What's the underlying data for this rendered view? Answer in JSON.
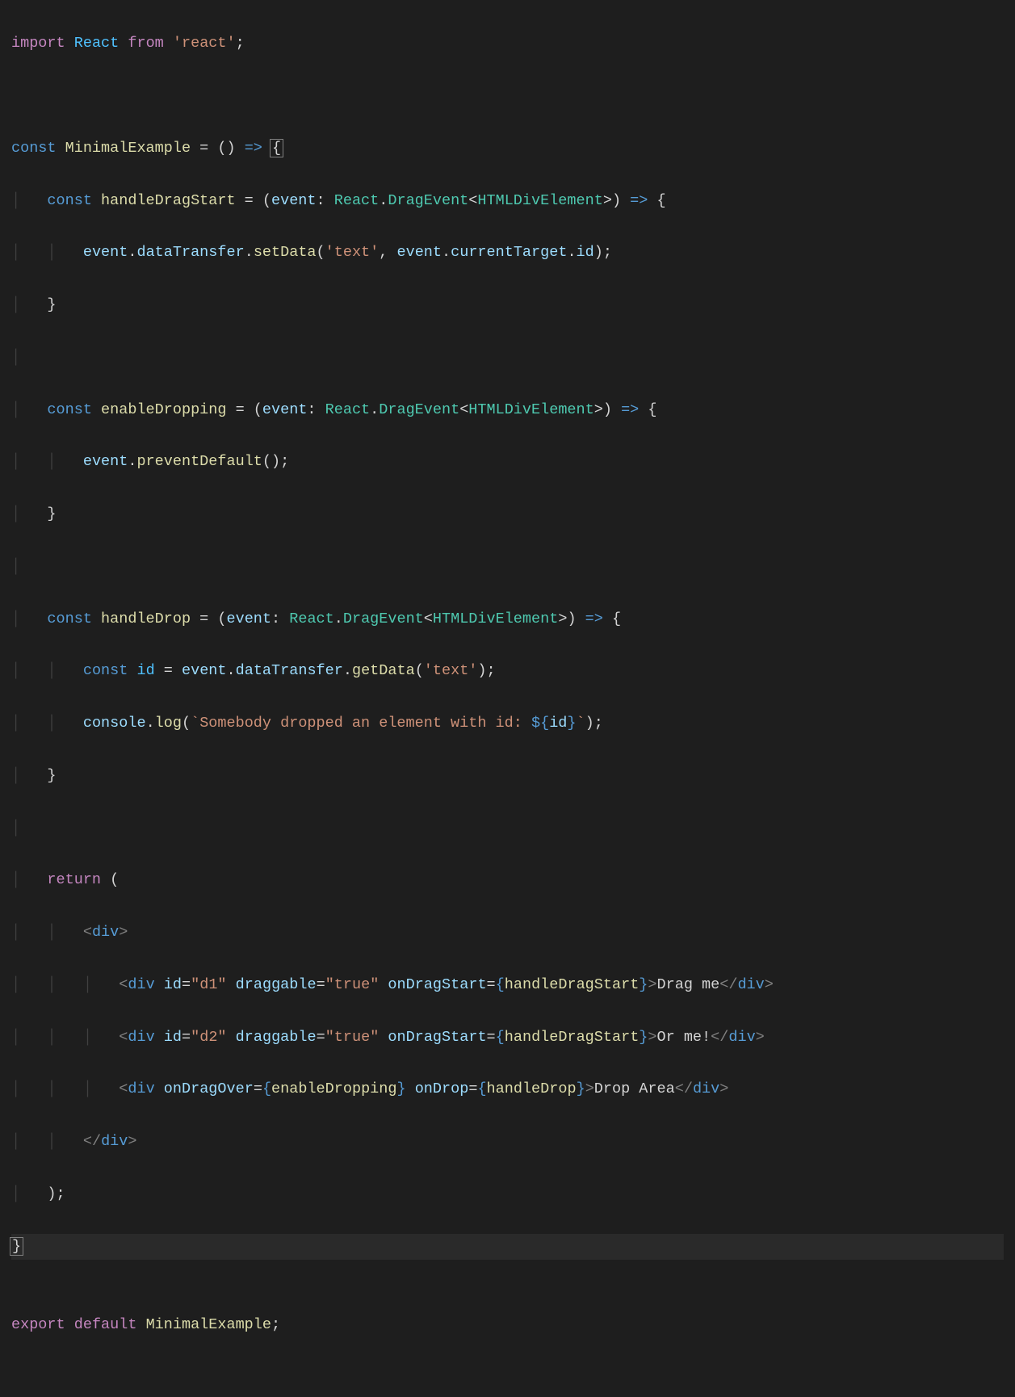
{
  "code": {
    "l1": {
      "import": "import",
      "react": "React",
      "from": "from",
      "pkg": "'react'",
      "semi": ";"
    },
    "l3": {
      "const": "const",
      "name": "MinimalExample",
      "eq": " = ",
      "parens": "()",
      "arrow": " => ",
      "brace": "{"
    },
    "l4": {
      "const": "const",
      "name": "handleDragStart",
      "eq": " = (",
      "param": "event",
      "colon": ": ",
      "ns": "React",
      "dot": ".",
      "type": "DragEvent",
      "lt": "<",
      "gen": "HTMLDivElement",
      "gt": ">",
      "close": ") ",
      "arrow": "=> ",
      "brace": "{"
    },
    "l5": {
      "ev": "event",
      "dot1": ".",
      "dt": "dataTransfer",
      "dot2": ".",
      "fn": "setData",
      "open": "(",
      "s1": "'text'",
      "comma": ", ",
      "ev2": "event",
      "dot3": ".",
      "ct": "currentTarget",
      "dot4": ".",
      "id": "id",
      "close": ");"
    },
    "l6": {
      "brace": "}"
    },
    "l8": {
      "const": "const",
      "name": "enableDropping",
      "eq": " = (",
      "param": "event",
      "colon": ": ",
      "ns": "React",
      "dot": ".",
      "type": "DragEvent",
      "lt": "<",
      "gen": "HTMLDivElement",
      "gt": ">",
      "close": ") ",
      "arrow": "=> ",
      "brace": "{"
    },
    "l9": {
      "ev": "event",
      "dot": ".",
      "fn": "preventDefault",
      "call": "();"
    },
    "l10": {
      "brace": "}"
    },
    "l12": {
      "const": "const",
      "name": "handleDrop",
      "eq": " = (",
      "param": "event",
      "colon": ": ",
      "ns": "React",
      "dot": ".",
      "type": "DragEvent",
      "lt": "<",
      "gen": "HTMLDivElement",
      "gt": ">",
      "close": ") ",
      "arrow": "=> ",
      "brace": "{"
    },
    "l13": {
      "const": "const",
      "name": "id",
      "eq": " = ",
      "ev": "event",
      "dot1": ".",
      "dt": "dataTransfer",
      "dot2": ".",
      "fn": "getData",
      "open": "(",
      "s1": "'text'",
      "close": ");"
    },
    "l14": {
      "obj": "console",
      "dot": ".",
      "fn": "log",
      "open": "(",
      "tpl1": "`Somebody dropped an element with id: ",
      "dollar": "${",
      "var": "id",
      "closebrace": "}",
      "tpl2": "`",
      "close": ");"
    },
    "l15": {
      "brace": "}"
    },
    "l17": {
      "return": "return",
      "open": " ("
    },
    "l18": {
      "lt": "<",
      "tag": "div",
      "gt": ">"
    },
    "l19": {
      "lt": "<",
      "tag": "div",
      "sp": " ",
      "a1": "id",
      "eq1": "=",
      "v1": "\"d1\"",
      "a2": "draggable",
      "eq2": "=",
      "v2": "\"true\"",
      "a3": "onDragStart",
      "eq3": "=",
      "ob": "{",
      "fn": "handleDragStart",
      "cb": "}",
      "gt": ">",
      "txt": "Drag me",
      "clt": "</",
      "ctag": "div",
      "cgt": ">"
    },
    "l20": {
      "lt": "<",
      "tag": "div",
      "sp": " ",
      "a1": "id",
      "eq1": "=",
      "v1": "\"d2\"",
      "a2": "draggable",
      "eq2": "=",
      "v2": "\"true\"",
      "a3": "onDragStart",
      "eq3": "=",
      "ob": "{",
      "fn": "handleDragStart",
      "cb": "}",
      "gt": ">",
      "txt": "Or me!",
      "clt": "</",
      "ctag": "div",
      "cgt": ">"
    },
    "l21": {
      "lt": "<",
      "tag": "div",
      "sp": " ",
      "a1": "onDragOver",
      "eq1": "=",
      "ob1": "{",
      "fn1": "enableDropping",
      "cb1": "}",
      "a2": "onDrop",
      "eq2": "=",
      "ob2": "{",
      "fn2": "handleDrop",
      "cb2": "}",
      "gt": ">",
      "txt": "Drop Area",
      "clt": "</",
      "ctag": "div",
      "cgt": ">"
    },
    "l22": {
      "clt": "</",
      "tag": "div",
      "gt": ">"
    },
    "l23": {
      "close": ");"
    },
    "l24": {
      "brace": "}"
    },
    "l26": {
      "export": "export",
      "default": "default",
      "name": "MinimalExample",
      "semi": ";"
    }
  },
  "indent": {
    "guide": "│",
    "i1": "    ",
    "i2": "        ",
    "i3": "            "
  }
}
